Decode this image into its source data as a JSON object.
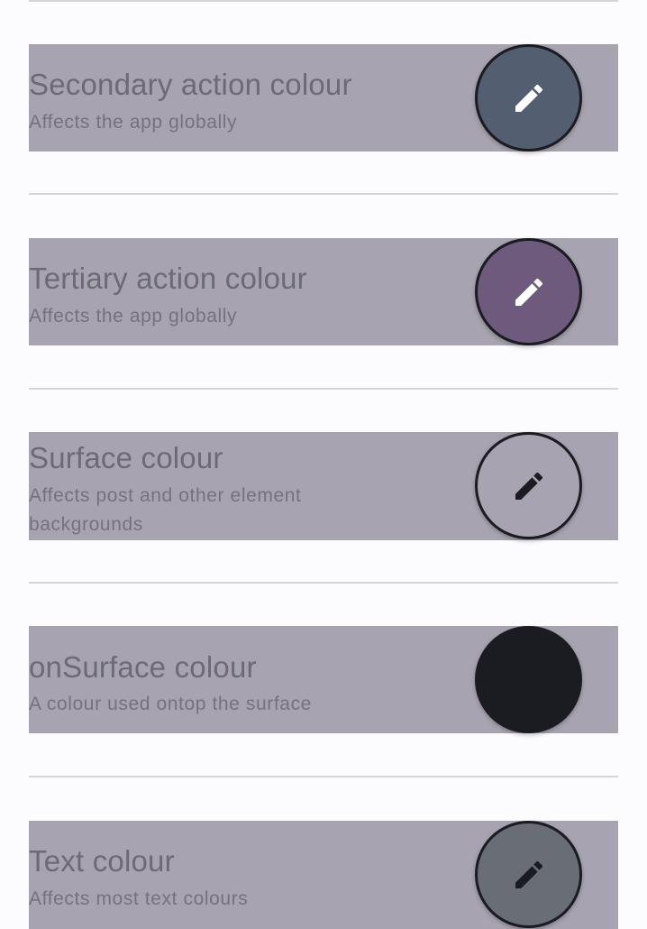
{
  "settings": [
    {
      "title": "Secondary action colour",
      "subtitle": "Affects the app globally",
      "swatch_color": "#535e71",
      "icon": "pencil-icon",
      "icon_color": "#ffffff"
    },
    {
      "title": "Tertiary action colour",
      "subtitle": "Affects the app globally",
      "swatch_color": "#6d5a7d",
      "icon": "pencil-icon",
      "icon_color": "#ffffff"
    },
    {
      "title": "Surface colour",
      "subtitle": "Affects post and other element backgrounds",
      "swatch_color": "#a7a3b0",
      "icon": "pencil-icon",
      "icon_color": "#1b1c21"
    },
    {
      "title": "onSurface colour",
      "subtitle": "A colour used ontop the surface",
      "swatch_color": "#1b1c21",
      "icon": "pencil-icon",
      "icon_color": "#1b1c21"
    },
    {
      "title": "Text colour",
      "subtitle": "Affects most text colours",
      "swatch_color": "#696e76",
      "icon": "pencil-icon",
      "icon_color": "#1b1c21"
    }
  ]
}
